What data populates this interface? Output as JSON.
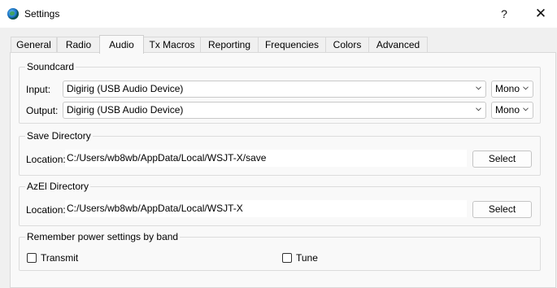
{
  "window": {
    "title": "Settings",
    "help": "?",
    "close": "✕"
  },
  "tabs": [
    {
      "label": "General"
    },
    {
      "label": "Radio"
    },
    {
      "label": "Audio"
    },
    {
      "label": "Tx Macros"
    },
    {
      "label": "Reporting"
    },
    {
      "label": "Frequencies"
    },
    {
      "label": "Colors"
    },
    {
      "label": "Advanced"
    }
  ],
  "active_tab": "Audio",
  "soundcard": {
    "title": "Soundcard",
    "input_label": "Input:",
    "input_device": "Digirig (USB Audio Device)",
    "input_channel": "Mono",
    "output_label": "Output:",
    "output_device": "Digirig (USB Audio Device)",
    "output_channel": "Mono"
  },
  "save_directory": {
    "title": "Save Directory",
    "location_label": "Location:",
    "path": "C:/Users/wb8wb/AppData/Local/WSJT-X/save",
    "button": "Select"
  },
  "azel_directory": {
    "title": "AzEl Directory",
    "location_label": "Location:",
    "path": "C:/Users/wb8wb/AppData/Local/WSJT-X",
    "button": "Select"
  },
  "power": {
    "title": "Remember power settings by band",
    "transmit": {
      "label": "Transmit",
      "checked": false
    },
    "tune": {
      "label": "Tune",
      "checked": false
    }
  }
}
